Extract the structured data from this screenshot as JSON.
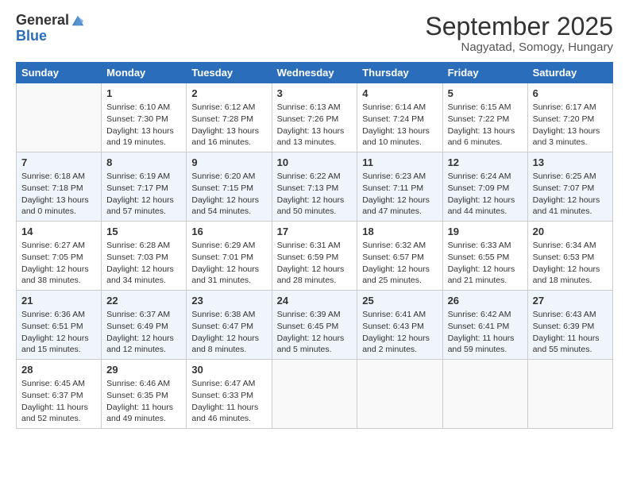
{
  "logo": {
    "general": "General",
    "blue": "Blue"
  },
  "header": {
    "month": "September 2025",
    "location": "Nagyatad, Somogy, Hungary"
  },
  "days": [
    "Sunday",
    "Monday",
    "Tuesday",
    "Wednesday",
    "Thursday",
    "Friday",
    "Saturday"
  ],
  "weeks": [
    [
      {
        "day": "",
        "sunrise": "",
        "sunset": "",
        "daylight": ""
      },
      {
        "day": "1",
        "sunrise": "Sunrise: 6:10 AM",
        "sunset": "Sunset: 7:30 PM",
        "daylight": "Daylight: 13 hours and 19 minutes."
      },
      {
        "day": "2",
        "sunrise": "Sunrise: 6:12 AM",
        "sunset": "Sunset: 7:28 PM",
        "daylight": "Daylight: 13 hours and 16 minutes."
      },
      {
        "day": "3",
        "sunrise": "Sunrise: 6:13 AM",
        "sunset": "Sunset: 7:26 PM",
        "daylight": "Daylight: 13 hours and 13 minutes."
      },
      {
        "day": "4",
        "sunrise": "Sunrise: 6:14 AM",
        "sunset": "Sunset: 7:24 PM",
        "daylight": "Daylight: 13 hours and 10 minutes."
      },
      {
        "day": "5",
        "sunrise": "Sunrise: 6:15 AM",
        "sunset": "Sunset: 7:22 PM",
        "daylight": "Daylight: 13 hours and 6 minutes."
      },
      {
        "day": "6",
        "sunrise": "Sunrise: 6:17 AM",
        "sunset": "Sunset: 7:20 PM",
        "daylight": "Daylight: 13 hours and 3 minutes."
      }
    ],
    [
      {
        "day": "7",
        "sunrise": "Sunrise: 6:18 AM",
        "sunset": "Sunset: 7:18 PM",
        "daylight": "Daylight: 13 hours and 0 minutes."
      },
      {
        "day": "8",
        "sunrise": "Sunrise: 6:19 AM",
        "sunset": "Sunset: 7:17 PM",
        "daylight": "Daylight: 12 hours and 57 minutes."
      },
      {
        "day": "9",
        "sunrise": "Sunrise: 6:20 AM",
        "sunset": "Sunset: 7:15 PM",
        "daylight": "Daylight: 12 hours and 54 minutes."
      },
      {
        "day": "10",
        "sunrise": "Sunrise: 6:22 AM",
        "sunset": "Sunset: 7:13 PM",
        "daylight": "Daylight: 12 hours and 50 minutes."
      },
      {
        "day": "11",
        "sunrise": "Sunrise: 6:23 AM",
        "sunset": "Sunset: 7:11 PM",
        "daylight": "Daylight: 12 hours and 47 minutes."
      },
      {
        "day": "12",
        "sunrise": "Sunrise: 6:24 AM",
        "sunset": "Sunset: 7:09 PM",
        "daylight": "Daylight: 12 hours and 44 minutes."
      },
      {
        "day": "13",
        "sunrise": "Sunrise: 6:25 AM",
        "sunset": "Sunset: 7:07 PM",
        "daylight": "Daylight: 12 hours and 41 minutes."
      }
    ],
    [
      {
        "day": "14",
        "sunrise": "Sunrise: 6:27 AM",
        "sunset": "Sunset: 7:05 PM",
        "daylight": "Daylight: 12 hours and 38 minutes."
      },
      {
        "day": "15",
        "sunrise": "Sunrise: 6:28 AM",
        "sunset": "Sunset: 7:03 PM",
        "daylight": "Daylight: 12 hours and 34 minutes."
      },
      {
        "day": "16",
        "sunrise": "Sunrise: 6:29 AM",
        "sunset": "Sunset: 7:01 PM",
        "daylight": "Daylight: 12 hours and 31 minutes."
      },
      {
        "day": "17",
        "sunrise": "Sunrise: 6:31 AM",
        "sunset": "Sunset: 6:59 PM",
        "daylight": "Daylight: 12 hours and 28 minutes."
      },
      {
        "day": "18",
        "sunrise": "Sunrise: 6:32 AM",
        "sunset": "Sunset: 6:57 PM",
        "daylight": "Daylight: 12 hours and 25 minutes."
      },
      {
        "day": "19",
        "sunrise": "Sunrise: 6:33 AM",
        "sunset": "Sunset: 6:55 PM",
        "daylight": "Daylight: 12 hours and 21 minutes."
      },
      {
        "day": "20",
        "sunrise": "Sunrise: 6:34 AM",
        "sunset": "Sunset: 6:53 PM",
        "daylight": "Daylight: 12 hours and 18 minutes."
      }
    ],
    [
      {
        "day": "21",
        "sunrise": "Sunrise: 6:36 AM",
        "sunset": "Sunset: 6:51 PM",
        "daylight": "Daylight: 12 hours and 15 minutes."
      },
      {
        "day": "22",
        "sunrise": "Sunrise: 6:37 AM",
        "sunset": "Sunset: 6:49 PM",
        "daylight": "Daylight: 12 hours and 12 minutes."
      },
      {
        "day": "23",
        "sunrise": "Sunrise: 6:38 AM",
        "sunset": "Sunset: 6:47 PM",
        "daylight": "Daylight: 12 hours and 8 minutes."
      },
      {
        "day": "24",
        "sunrise": "Sunrise: 6:39 AM",
        "sunset": "Sunset: 6:45 PM",
        "daylight": "Daylight: 12 hours and 5 minutes."
      },
      {
        "day": "25",
        "sunrise": "Sunrise: 6:41 AM",
        "sunset": "Sunset: 6:43 PM",
        "daylight": "Daylight: 12 hours and 2 minutes."
      },
      {
        "day": "26",
        "sunrise": "Sunrise: 6:42 AM",
        "sunset": "Sunset: 6:41 PM",
        "daylight": "Daylight: 11 hours and 59 minutes."
      },
      {
        "day": "27",
        "sunrise": "Sunrise: 6:43 AM",
        "sunset": "Sunset: 6:39 PM",
        "daylight": "Daylight: 11 hours and 55 minutes."
      }
    ],
    [
      {
        "day": "28",
        "sunrise": "Sunrise: 6:45 AM",
        "sunset": "Sunset: 6:37 PM",
        "daylight": "Daylight: 11 hours and 52 minutes."
      },
      {
        "day": "29",
        "sunrise": "Sunrise: 6:46 AM",
        "sunset": "Sunset: 6:35 PM",
        "daylight": "Daylight: 11 hours and 49 minutes."
      },
      {
        "day": "30",
        "sunrise": "Sunrise: 6:47 AM",
        "sunset": "Sunset: 6:33 PM",
        "daylight": "Daylight: 11 hours and 46 minutes."
      },
      {
        "day": "",
        "sunrise": "",
        "sunset": "",
        "daylight": ""
      },
      {
        "day": "",
        "sunrise": "",
        "sunset": "",
        "daylight": ""
      },
      {
        "day": "",
        "sunrise": "",
        "sunset": "",
        "daylight": ""
      },
      {
        "day": "",
        "sunrise": "",
        "sunset": "",
        "daylight": ""
      }
    ]
  ]
}
